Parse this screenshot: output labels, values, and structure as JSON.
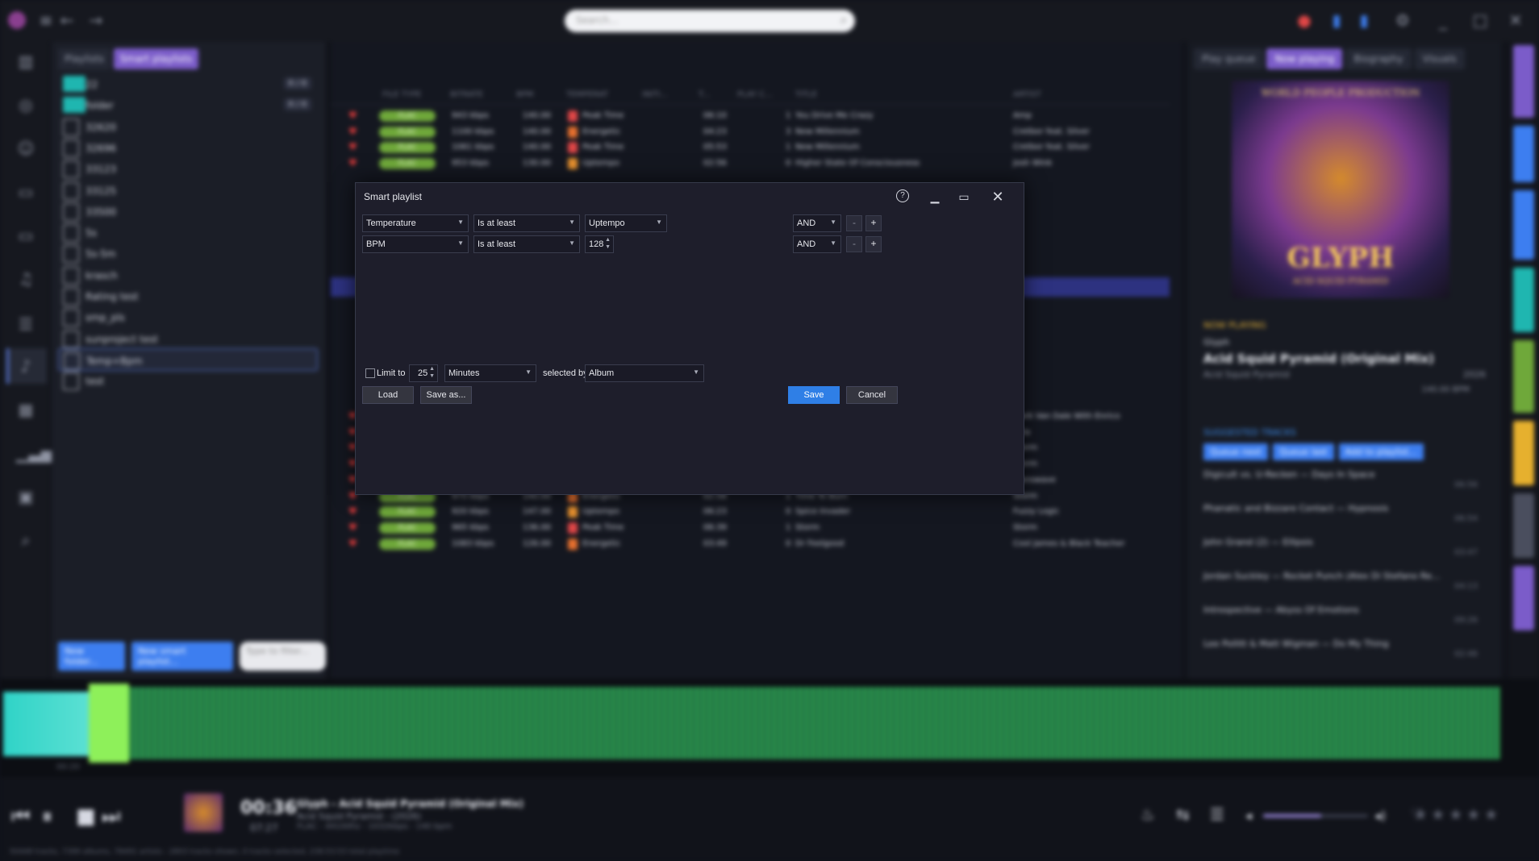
{
  "topbar": {
    "search_placeholder": "Search..."
  },
  "playlists": {
    "tabs": [
      "Playlists",
      "Smart playlists"
    ],
    "items": [
      {
        "label": "22",
        "count": "0 / 0",
        "folder": true
      },
      {
        "label": "folder",
        "count": "0 / 0",
        "folder": true
      },
      {
        "label": "32620"
      },
      {
        "label": "32696"
      },
      {
        "label": "33123"
      },
      {
        "label": "33125"
      },
      {
        "label": "33500"
      },
      {
        "label": "5s"
      },
      {
        "label": "5s-5m"
      },
      {
        "label": "krasch"
      },
      {
        "label": "Rating test"
      },
      {
        "label": "smp_pls"
      },
      {
        "label": "sunproject test"
      },
      {
        "label": "Temp+Bpm"
      },
      {
        "label": "test"
      }
    ],
    "new_folder": "New folder...",
    "new_smart": "New smart playlist...",
    "filter_placeholder": "Type to filter..."
  },
  "tracks": {
    "headers": [
      "FILE TYPE",
      "BITRATE",
      "BPM",
      "TEMPERAT",
      "INITI...",
      "T...",
      "PLAY C...",
      "TITLE",
      "ARTIST"
    ],
    "rows_top": [
      {
        "bitrate": "943 kbps",
        "bpm": "140.00",
        "temp": "Peak Time",
        "len": "06:10",
        "plays": "1",
        "title": "You Drive Me Crazy",
        "artist": "Amp",
        "color": "#e04646"
      },
      {
        "bitrate": "1100 kbps",
        "bpm": "140.00",
        "temp": "Energetic",
        "len": "04:23",
        "plays": "3",
        "title": "New Millennium",
        "artist": "Cretbor feat. Silver",
        "color": "#e6702e"
      },
      {
        "bitrate": "1061 kbps",
        "bpm": "140.00",
        "temp": "Peak Time",
        "len": "05:53",
        "plays": "1",
        "title": "New Millennium",
        "artist": "Cretbor feat. Silver",
        "color": "#e04646"
      },
      {
        "bitrate": "953 kbps",
        "bpm": "130.00",
        "temp": "Uptempo",
        "len": "02:56",
        "plays": "0",
        "title": "Higher State Of Consciousness",
        "artist": "Josh Wink",
        "color": "#e6902e"
      }
    ],
    "rows_bottom": [
      {
        "bitrate": "838 kbps",
        "bpm": "134.00",
        "temp": "Uptempo",
        "len": "06:19",
        "plays": "1",
        "title": "Power Woman",
        "artist": "Mark Van Dale With Enrico",
        "color": "#e6902e"
      },
      {
        "bitrate": "923 kbps",
        "bpm": "137.00",
        "temp": "Uptempo",
        "len": "03:45",
        "plays": "0",
        "title": "Angelfalls",
        "artist": "Ayla",
        "color": "#e6902e"
      },
      {
        "bitrate": "913 kbps",
        "bpm": "132.00",
        "temp": "Energetic",
        "len": "03:51",
        "plays": "1",
        "title": "Hun-Khan",
        "artist": "Storm",
        "color": "#e6702e"
      },
      {
        "bitrate": "769 kbps",
        "bpm": "132.00",
        "temp": "Uptempo",
        "len": "03:44",
        "plays": "2",
        "title": "Storm",
        "artist": "Storm",
        "color": "#e6902e"
      },
      {
        "bitrate": "1014 kbps",
        "bpm": "147.00",
        "temp": "Uptempo",
        "len": "06:23",
        "plays": "1",
        "title": "The Reawaker",
        "artist": "Transwave",
        "color": "#e6902e"
      },
      {
        "bitrate": "975 kbps",
        "bpm": "140.00",
        "temp": "Energetic",
        "len": "02:58",
        "plays": "1",
        "title": "Time To Burn",
        "artist": "Storm",
        "color": "#e6702e"
      },
      {
        "bitrate": "920 kbps",
        "bpm": "147.00",
        "temp": "Uptempo",
        "len": "06:23",
        "plays": "0",
        "title": "Spice Invader",
        "artist": "Fuzzy Logic",
        "color": "#e6902e"
      },
      {
        "bitrate": "965 kbps",
        "bpm": "136.00",
        "temp": "Peak Time",
        "len": "06:39",
        "plays": "1",
        "title": "Storm",
        "artist": "Storm",
        "color": "#e04646"
      },
      {
        "bitrate": "1083 kbps",
        "bpm": "126.00",
        "temp": "Energetic",
        "len": "03:49",
        "plays": "0",
        "title": "Dr Feelgood",
        "artist": "Cool James & Black Teacher",
        "color": "#e6702e"
      }
    ],
    "ft_label": "FLAC"
  },
  "right": {
    "tabs": [
      "Play queue",
      "Now playing",
      "Biography",
      "Visuals"
    ],
    "cover_top": "WORLD PEOPLE PRODUCTION",
    "cover_title": "GLYPH",
    "cover_sub": "ACID SQUID PYRAMID",
    "now_playing": "NOW PLAYING",
    "artist": "Glyph",
    "title": "Acid Squid Pyramid (Original Mix)",
    "album": "Acid Squid Pyramid",
    "year": "2026",
    "bpm": "140.00 BPM",
    "suggested": "SUGGESTED TRACKS",
    "buttons": [
      "Queue next",
      "Queue last",
      "Add to playlist..."
    ],
    "suggestions": [
      {
        "text": "Digicult vs. U-Recken — Days In Space",
        "dur": "06:56"
      },
      {
        "text": "Phanatic and Bizzare Contact — Hypnosis",
        "dur": "06:54"
      },
      {
        "text": "John Grand (2) — Ellipsis",
        "dur": "03:47"
      },
      {
        "text": "Jordan Suckley — Rocket Punch (Alex Di Stefano Re...",
        "dur": "04:13"
      },
      {
        "text": "Introspective — Abyss Of Emotions",
        "dur": "09:26"
      },
      {
        "text": "Lee Pollitt & Matt Wigman — Do My Thing",
        "dur": "02:46"
      }
    ]
  },
  "waveform": {
    "time_label": "00:20"
  },
  "player": {
    "elapsed": "00:36",
    "total": "07:27",
    "line1": "Glyph - Acid Squid Pyramid (Original Mix)",
    "line2": "Acid Squid Pyramid - (2026)",
    "line3": "FLAC - 44100hz - 1032kbps - 140 bpm",
    "volume": 0.55,
    "status": "50448 tracks, 7399 albums, 78491 artists - 2803 tracks shown, 0 tracks selected, 238:53:53 total playtime"
  },
  "dialog": {
    "title": "Smart playlist",
    "help": "?",
    "rows": [
      {
        "field": "Temperature",
        "op": "Is at least",
        "value": "Uptempo",
        "logic": "AND",
        "value_kind": "combo"
      },
      {
        "field": "BPM",
        "op": "Is at least",
        "value": "128",
        "logic": "AND",
        "value_kind": "spin"
      }
    ],
    "minus": "-",
    "plus": "+",
    "limit_label": "Limit to",
    "limit_value": "25",
    "limit_unit": "Minutes",
    "selected_by_label": "selected by",
    "selected_by": "Album",
    "load": "Load",
    "save_as": "Save as...",
    "save": "Save",
    "cancel": "Cancel"
  }
}
